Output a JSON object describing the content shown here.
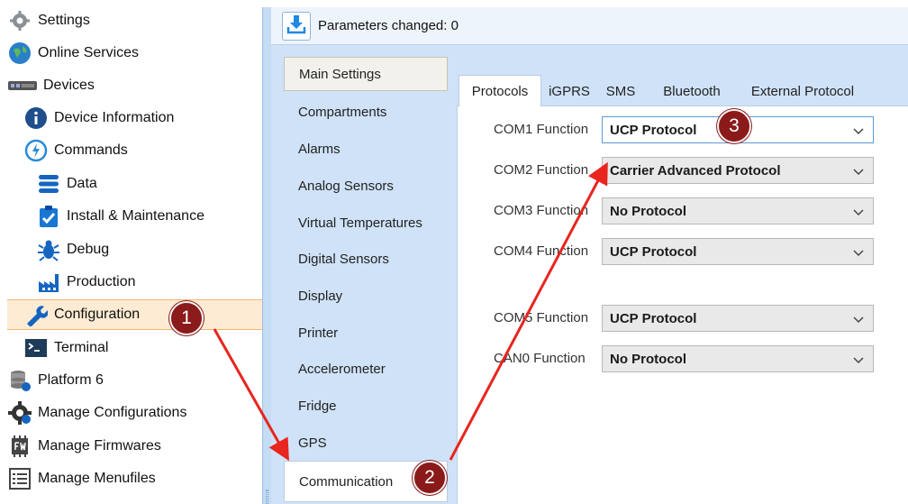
{
  "tree": {
    "items": [
      {
        "label": "Settings",
        "icon": "gear-icon"
      },
      {
        "label": "Online Services",
        "icon": "globe-icon"
      },
      {
        "label": "Devices",
        "icon": "devices-icon"
      },
      {
        "label": "Device Information",
        "icon": "info-icon"
      },
      {
        "label": "Commands",
        "icon": "commands-icon"
      },
      {
        "label": "Data",
        "icon": "database-icon"
      },
      {
        "label": "Install & Maintenance",
        "icon": "clipboard-check-icon"
      },
      {
        "label": "Debug",
        "icon": "bug-icon"
      },
      {
        "label": "Production",
        "icon": "factory-icon"
      },
      {
        "label": "Configuration",
        "icon": "wrench-icon"
      },
      {
        "label": "Terminal",
        "icon": "terminal-icon"
      },
      {
        "label": "Platform 6",
        "icon": "database-stack-icon"
      },
      {
        "label": "Manage Configurations",
        "icon": "gear-settings-icon"
      },
      {
        "label": "Manage Firmwares",
        "icon": "firmware-chip-icon"
      },
      {
        "label": "Manage Menufiles",
        "icon": "menu-list-icon"
      }
    ],
    "selected": "Configuration"
  },
  "toolbar": {
    "parameters_changed": "Parameters changed: 0"
  },
  "categories": [
    "Main Settings",
    "Compartments",
    "Alarms",
    "Analog Sensors",
    "Virtual Temperatures",
    "Digital Sensors",
    "Display",
    "Printer",
    "Accelerometer",
    "Fridge",
    "GPS",
    "Communication"
  ],
  "tabs": [
    "Protocols",
    "iGPRS",
    "SMS",
    "Bluetooth",
    "External Protocol"
  ],
  "active_tab": "Protocols",
  "fields": [
    {
      "label": "COM1 Function",
      "value": "UCP Protocol"
    },
    {
      "label": "COM2 Function",
      "value": "Carrier Advanced Protocol"
    },
    {
      "label": "COM3 Function",
      "value": "No Protocol"
    },
    {
      "label": "COM4 Function",
      "value": "UCP Protocol"
    },
    {
      "label": "COM5 Function",
      "value": "UCP Protocol"
    },
    {
      "label": "CAN0 Function",
      "value": "No Protocol"
    }
  ],
  "callouts": [
    "1",
    "2",
    "3"
  ],
  "colors": {
    "callout": "#8b1a1a",
    "arrow": "#e8251e",
    "selection": "#fdebd3",
    "panel": "#cfe2f7"
  }
}
